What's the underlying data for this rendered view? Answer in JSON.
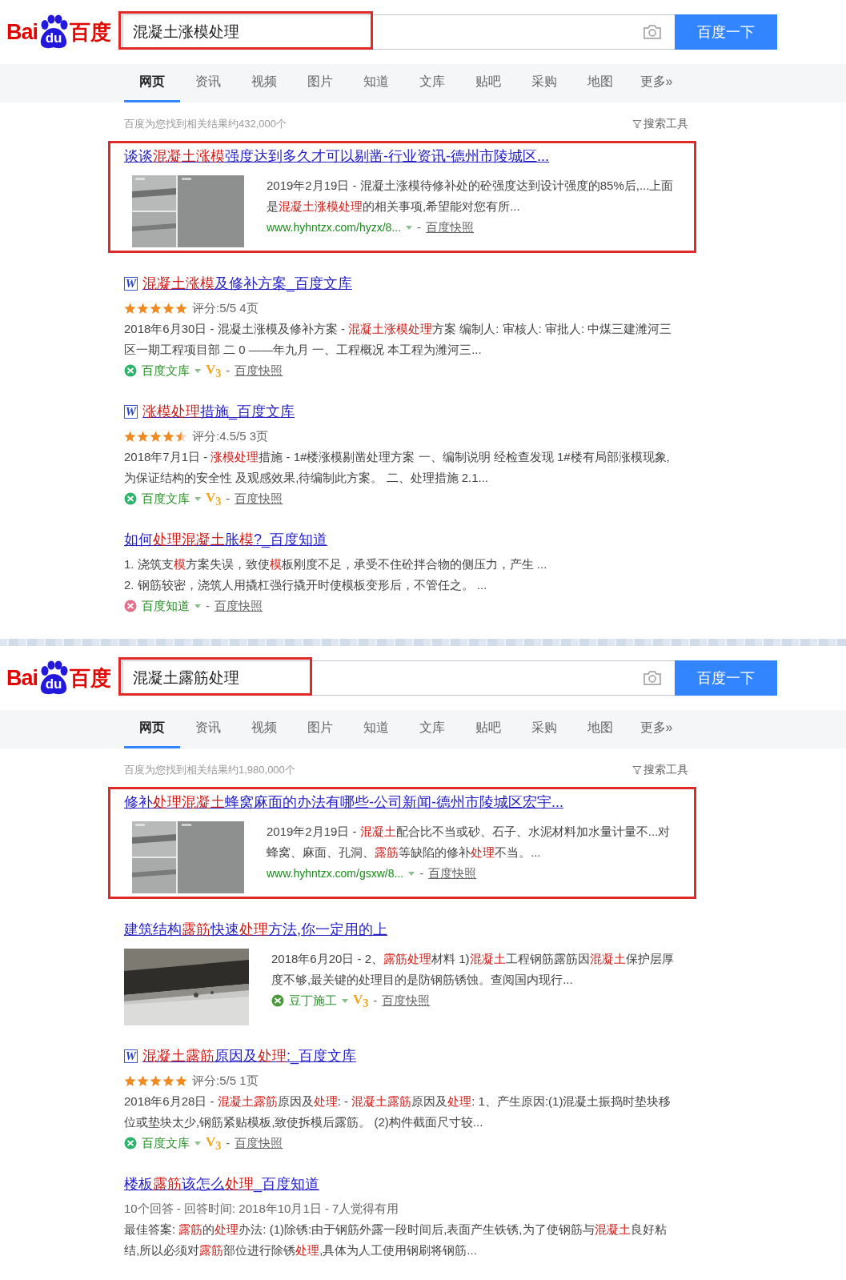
{
  "panels": [
    {
      "logo": {
        "left": "Bai",
        "paw": "du",
        "right": "百度"
      },
      "query": "混凝土涨模处理",
      "query_annotated": true,
      "search_button": "百度一下",
      "tabs": [
        {
          "label": "网页",
          "selected": true
        },
        {
          "label": "资讯",
          "selected": false
        },
        {
          "label": "视频",
          "selected": false
        },
        {
          "label": "图片",
          "selected": false
        },
        {
          "label": "知道",
          "selected": false
        },
        {
          "label": "文库",
          "selected": false
        },
        {
          "label": "贴吧",
          "selected": false
        },
        {
          "label": "采购",
          "selected": false
        },
        {
          "label": "地图",
          "selected": false
        },
        {
          "label": "更多»",
          "selected": false
        }
      ],
      "result_count": "百度为您找到相关结果约432,000个",
      "tools": "搜索工具",
      "results": [
        {
          "kind": "thumb",
          "annotated": true,
          "title": "谈谈**混凝土涨模**强度达到多久才可以剔凿-行业资讯-德州市陵城区...",
          "snippet": "2019年2月19日 - 混凝土涨模待修补处的砼强度达到设计强度的85%后,...上面是**混凝土涨模处理**的相关事项,希望能对您有所...",
          "source": {
            "kind": "url",
            "text": "www.hyhntzx.com/hyzx/8...",
            "separator": "-",
            "snapshot": "百度快照"
          }
        },
        {
          "kind": "doc",
          "annotated": false,
          "file_icon": "W",
          "title": "**混凝土涨模**及修补方案_百度文库",
          "stars": 5,
          "rating": "评分:5/5 4页",
          "snippet": "2018年6月30日 - 混凝土涨模及修补方案 - **混凝土涨模处理**方案 编制人: 审核人: 审批人: 中煤三建潍河三区一期工程项目部 二 0 ——年九月 一、工程概况 本工程为潍河三...",
          "source": {
            "kind": "app",
            "color": "#2fb36a",
            "text": "百度文库",
            "badge": "V$_{3}$",
            "separator": "-",
            "snapshot": "百度快照"
          }
        },
        {
          "kind": "doc",
          "annotated": false,
          "file_icon": "W",
          "title": "**涨模处理**措施_百度文库",
          "stars": 4.5,
          "rating": "评分:4.5/5 3页",
          "snippet": "2018年7月1日 - **涨模处理**措施 - 1#楼涨模剔凿处理方案 一、编制说明 经检查发现 1#楼有局部涨模现象,为保证结构的安全性 及观感效果,待编制此方案。 二、处理措施 2.1...",
          "source": {
            "kind": "app",
            "color": "#2fb36a",
            "text": "百度文库",
            "badge": "V$_{3}$",
            "separator": "-",
            "snapshot": "百度快照"
          }
        },
        {
          "kind": "qa",
          "annotated": false,
          "title": "如何**处理混凝土**胀**模**?_百度知道",
          "lines": [
            "1. 浇筑支**模**方案失误，致使**模**板刚度不足，承受不住砼拌合物的侧压力，产生 ...",
            "2. 钢筋较密，浇筑人用撬杠强行撬开时使模板变形后，不管任之。 ..."
          ],
          "source": {
            "kind": "app",
            "color": "#e3708a",
            "text": "百度知道",
            "separator": "-",
            "snapshot": "百度快照"
          }
        }
      ]
    },
    {
      "logo": {
        "left": "Bai",
        "paw": "du",
        "right": "百度"
      },
      "query": "混凝土露筋处理",
      "query_annotated": true,
      "search_button": "百度一下",
      "tabs": [
        {
          "label": "网页",
          "selected": true
        },
        {
          "label": "资讯",
          "selected": false
        },
        {
          "label": "视频",
          "selected": false
        },
        {
          "label": "图片",
          "selected": false
        },
        {
          "label": "知道",
          "selected": false
        },
        {
          "label": "文库",
          "selected": false
        },
        {
          "label": "贴吧",
          "selected": false
        },
        {
          "label": "采购",
          "selected": false
        },
        {
          "label": "地图",
          "selected": false
        },
        {
          "label": "更多»",
          "selected": false
        }
      ],
      "result_count": "百度为您找到相关结果约1,980,000个",
      "tools": "搜索工具",
      "results": [
        {
          "kind": "thumb",
          "annotated": true,
          "title": "修补**处理混凝土**蜂窝麻面的办法有哪些-公司新闻-德州市陵城区宏宇...",
          "snippet": "2019年2月19日 - **混凝土**配合比不当或砂、石子、水泥材料加水量计量不...对蜂窝、麻面、孔洞、**露筋**等缺陷的修补**处理**不当。...",
          "source": {
            "kind": "url",
            "text": "www.hyhntzx.com/gsxw/8...",
            "separator": "-",
            "snapshot": "百度快照"
          }
        },
        {
          "kind": "thumb",
          "annotated": false,
          "title": "建筑结构**露筋**快速**处理**方法,你一定用的上",
          "snippet": "2018年6月20日 - 2、**露筋处理**材料 1)**混凝土**工程钢筋露筋因**混凝土**保护层厚度不够,最关键的处理目的是防钢筋锈蚀。查阅国内现行...",
          "source": {
            "kind": "app",
            "color": "#4a9a3a",
            "text": "豆丁施工",
            "badge": "V$_{3}$",
            "separator": "-",
            "snapshot": "百度快照"
          }
        },
        {
          "kind": "doc",
          "annotated": false,
          "file_icon": "W",
          "title": "**混凝土露筋**原因及**处理**:_百度文库",
          "stars": 5,
          "rating": "评分:5/5 1页",
          "snippet": "2018年6月28日 - **混凝土露筋**原因及**处理**: - **混凝土露筋**原因及**处理**: 1、产生原因:(1)混凝土振捣时垫块移位或垫块太少,钢筋紧贴模板,致使拆模后露筋。 (2)构件截面尺寸较...",
          "source": {
            "kind": "app",
            "color": "#2fb36a",
            "text": "百度文库",
            "badge": "V$_{3}$",
            "separator": "-",
            "snapshot": "百度快照"
          }
        },
        {
          "kind": "qa",
          "annotated": false,
          "title": "楼板**露筋**该怎么**处理**_百度知道",
          "meta": "10个回答 - 回答时间: 2018年10月1日 - 7人觉得有用",
          "snippet": "最佳答案: **露筋**的**处理**办法: (1)除锈:由于钢筋外露一段时间后,表面产生铁锈,为了使钢筋与**混凝土**良好粘结,所以必须对**露筋**部位进行除锈**处理**,具体为人工使用钢刷将钢筋..."
        }
      ]
    }
  ]
}
